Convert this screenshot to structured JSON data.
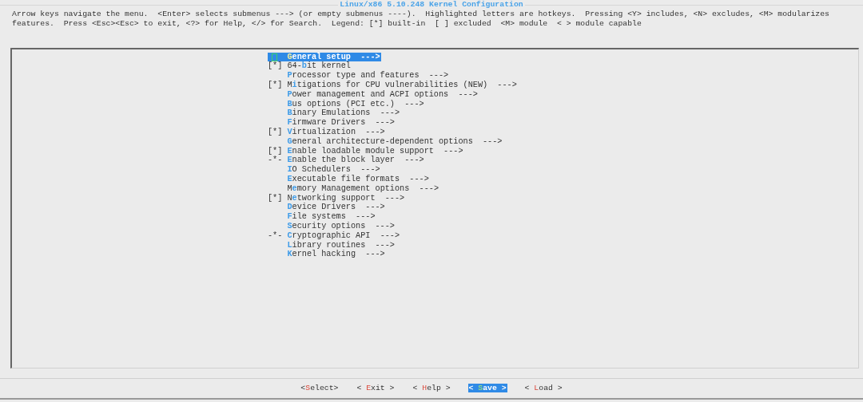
{
  "window": {
    "title": "Linux/x86 5.10.248 Kernel Configuration"
  },
  "help_text": [
    "Arrow keys navigate the menu.  <Enter> selects submenus ---> (or empty submenus ----).  Highlighted letters are hotkeys.  Pressing <Y> includes, <N> excludes, <M> modularizes",
    "features.  Press <Esc><Esc> to exit, <?> for Help, </> for Search.  Legend: [*] built-in  [ ] excluded  <M> module  < > module capable"
  ],
  "menu": [
    {
      "hotkey": "G",
      "post": "eneral setup",
      "arrow": "--->",
      "selected": true
    },
    {
      "status": "[*]",
      "pre": "64-",
      "hotkey": "b",
      "post": "it kernel",
      "selected": false
    },
    {
      "hotkey": "P",
      "post": "rocessor type and features",
      "arrow": "--->",
      "selected": false
    },
    {
      "status": "[*]",
      "pre": "M",
      "hotkey": "i",
      "post": "tigations for CPU vulnerabilities (NEW)",
      "arrow": "--->",
      "selected": false
    },
    {
      "hotkey": "P",
      "post": "ower management and ACPI options",
      "arrow": "--->",
      "selected": false
    },
    {
      "hotkey": "B",
      "post": "us options (PCI etc.)",
      "arrow": "--->",
      "selected": false
    },
    {
      "hotkey": "B",
      "post": "inary Emulations",
      "arrow": "--->",
      "selected": false
    },
    {
      "hotkey": "F",
      "post": "irmware Drivers",
      "arrow": "--->",
      "selected": false
    },
    {
      "status": "[*]",
      "hotkey": "V",
      "post": "irtualization",
      "arrow": "--->",
      "selected": false
    },
    {
      "hotkey": "G",
      "post": "eneral architecture-dependent options",
      "arrow": "--->",
      "selected": false
    },
    {
      "status": "[*]",
      "hotkey": "E",
      "post": "nable loadable module support",
      "arrow": "--->",
      "selected": false
    },
    {
      "status": "-*-",
      "hotkey": "E",
      "post": "nable the block layer",
      "arrow": "--->",
      "selected": false
    },
    {
      "hotkey": "I",
      "post": "O Schedulers",
      "arrow": "--->",
      "selected": false
    },
    {
      "hotkey": "E",
      "post": "xecutable file formats",
      "arrow": "--->",
      "selected": false
    },
    {
      "pre": "M",
      "hotkey": "e",
      "post": "mory Management options",
      "arrow": "--->",
      "selected": false
    },
    {
      "status": "[*]",
      "pre": "N",
      "hotkey": "e",
      "post": "tworking support",
      "arrow": "--->",
      "selected": false
    },
    {
      "hotkey": "D",
      "post": "evice Drivers",
      "arrow": "--->",
      "selected": false
    },
    {
      "hotkey": "F",
      "post": "ile systems",
      "arrow": "--->",
      "selected": false
    },
    {
      "hotkey": "S",
      "post": "ecurity options",
      "arrow": "--->",
      "selected": false
    },
    {
      "status": "-*-",
      "hotkey": "C",
      "post": "ryptographic API",
      "arrow": "--->",
      "selected": false
    },
    {
      "hotkey": "L",
      "post": "ibrary routines",
      "arrow": "--->",
      "selected": false
    },
    {
      "hotkey": "K",
      "post": "ernel hacking",
      "arrow": "--->",
      "selected": false
    }
  ],
  "buttons": [
    {
      "pre": "<",
      "hotkey": "S",
      "post": "elect>",
      "selected": false
    },
    {
      "pre": "< ",
      "hotkey": "E",
      "post": "xit >",
      "selected": false
    },
    {
      "pre": "< ",
      "hotkey": "H",
      "post": "elp >",
      "selected": false
    },
    {
      "pre": "< ",
      "hotkey": "S",
      "post": "ave >",
      "selected": true
    },
    {
      "pre": "< ",
      "hotkey": "L",
      "post": "oad >",
      "selected": false
    }
  ]
}
